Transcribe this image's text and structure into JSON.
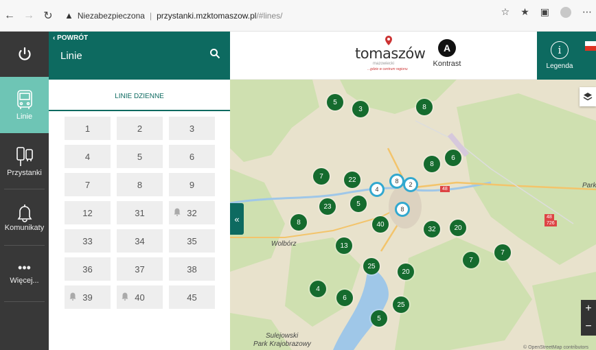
{
  "browser": {
    "insecure_label": "Niezabezpieczona",
    "separator": "|",
    "host": "przystanki.mzktomaszow.pl",
    "path": "/#lines/"
  },
  "sidebar": {
    "items": [
      {
        "label": "Linie",
        "icon": "bus-icon"
      },
      {
        "label": "Przystanki",
        "icon": "bus-stop-icon"
      },
      {
        "label": "Komunikaty",
        "icon": "bell-icon"
      },
      {
        "label": "Więcej...",
        "icon": "more-icon"
      }
    ]
  },
  "panel": {
    "back_label": "POWRÓT",
    "title": "Linie",
    "tab_label": "LINIE DZIENNE",
    "lines": [
      {
        "number": "1",
        "alert": false
      },
      {
        "number": "2",
        "alert": false
      },
      {
        "number": "3",
        "alert": false
      },
      {
        "number": "4",
        "alert": false
      },
      {
        "number": "5",
        "alert": false
      },
      {
        "number": "6",
        "alert": false
      },
      {
        "number": "7",
        "alert": false
      },
      {
        "number": "8",
        "alert": false
      },
      {
        "number": "9",
        "alert": false
      },
      {
        "number": "12",
        "alert": false
      },
      {
        "number": "31",
        "alert": false
      },
      {
        "number": "32",
        "alert": true
      },
      {
        "number": "33",
        "alert": false
      },
      {
        "number": "34",
        "alert": false
      },
      {
        "number": "35",
        "alert": false
      },
      {
        "number": "36",
        "alert": false
      },
      {
        "number": "37",
        "alert": false
      },
      {
        "number": "38",
        "alert": false
      },
      {
        "number": "39",
        "alert": true
      },
      {
        "number": "40",
        "alert": true
      },
      {
        "number": "45",
        "alert": false
      }
    ]
  },
  "header": {
    "logo_text": "tomaszów",
    "logo_sub": "mazowiecki",
    "logo_tagline": "...gdzie w centrum regionu",
    "contrast_letter": "A",
    "contrast_label": "Kontrast",
    "legend_icon": "i",
    "legend_label": "Legenda"
  },
  "map": {
    "labels": {
      "wolborz": "Wolbórz",
      "park1": "Sulejowski",
      "park2": "Park Krajobrazowy",
      "right": "Park",
      "road48": "48",
      "road48b": "48",
      "road726": "726"
    },
    "clusters": [
      "5",
      "3",
      "8",
      "8",
      "6",
      "7",
      "22",
      "23",
      "5",
      "8",
      "40",
      "32",
      "20",
      "13",
      "7",
      "7",
      "25",
      "20",
      "4",
      "6",
      "25",
      "5"
    ],
    "pins": [
      "8",
      "2",
      "4",
      "8"
    ],
    "copyright": "© OpenStreetMap contributors"
  },
  "colors": {
    "primary": "#0d6a60",
    "active_tab": "#6ec5b5",
    "sidebar_bg": "#383838",
    "cluster": "#156b2e",
    "pin_border": "#32a8cf"
  }
}
